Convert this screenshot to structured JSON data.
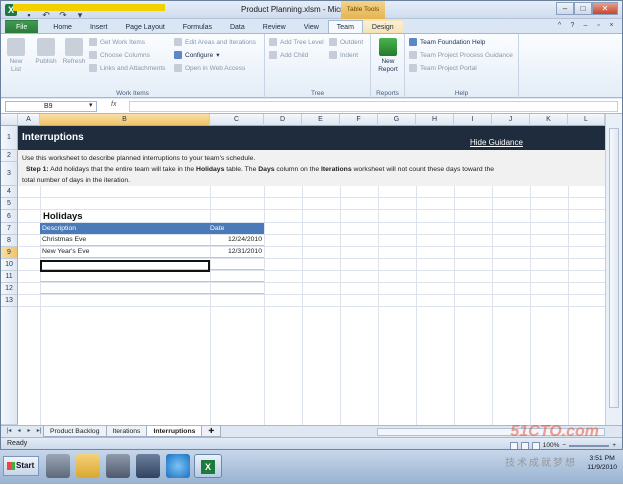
{
  "window": {
    "title": "Product Planning.xlsm - Microsoft Excel",
    "context_tab_group": "Table Tools"
  },
  "ribbon_tabs": [
    "File",
    "Home",
    "Insert",
    "Page Layout",
    "Formulas",
    "Data",
    "Review",
    "View",
    "Team",
    "Design"
  ],
  "ribbon": {
    "work_items": {
      "label": "Work Items",
      "new_list": "New\nList",
      "publish": "Publish",
      "refresh": "Refresh",
      "get_work_items": "Get Work Items",
      "choose_columns": "Choose Columns",
      "links_attachments": "Links and Attachments",
      "edit_areas": "Edit Areas and Iterations",
      "configure": "Configure",
      "open_web": "Open in Web Access"
    },
    "tree": {
      "label": "Tree",
      "add_tree_level": "Add Tree Level",
      "add_child": "Add Child",
      "outdent": "Outdent",
      "indent": "Indent"
    },
    "reports": {
      "label": "Reports",
      "new_report": "New\nReport"
    },
    "help": {
      "label": "Help",
      "tf_help": "Team Foundation Help",
      "process_guidance": "Team Project Process Guidance",
      "portal": "Team Project Portal"
    }
  },
  "formula_bar": {
    "name_box": "B9",
    "fx": "fx",
    "formula": ""
  },
  "columns": [
    "A",
    "B",
    "C",
    "D",
    "E",
    "F",
    "G",
    "H",
    "I",
    "J",
    "K",
    "L"
  ],
  "rows": [
    "1",
    "2",
    "3",
    "4",
    "5",
    "6",
    "7",
    "8",
    "9",
    "10",
    "11",
    "12",
    "13"
  ],
  "sheet": {
    "banner_title": "Interruptions",
    "hide_guidance": "Hide Guidance",
    "desc_line1": "Use this worksheet to describe planned interruptions to your team's schedule.",
    "step_prefix": "Step 1:",
    "step_text_a": "  Add holidays that the entire team will take in the ",
    "step_bold1": "Holidays",
    "step_text_b": " table.  The ",
    "step_bold2": "Days",
    "step_text_c": " column on the ",
    "step_bold3": "Iterations",
    "step_text_d": " worksheet will not count these days toward the",
    "desc_line3": "total number of days in the iteration.",
    "holidays_title": "Holidays",
    "table_headers": [
      "Description",
      "Date"
    ],
    "table_rows": [
      [
        "Christmas Eve",
        "12/24/2010"
      ],
      [
        "New Year's Eve",
        "12/31/2010"
      ]
    ]
  },
  "sheet_tabs": [
    "Product Backlog",
    "Iterations",
    "Interruptions"
  ],
  "status": {
    "ready": "Ready",
    "zoom": "100%"
  },
  "taskbar": {
    "start": "Start",
    "time": "3:51 PM",
    "date": "11/9/2010"
  },
  "watermark": {
    "site": "51CTO.com",
    "tagline": "技术成就梦想"
  }
}
